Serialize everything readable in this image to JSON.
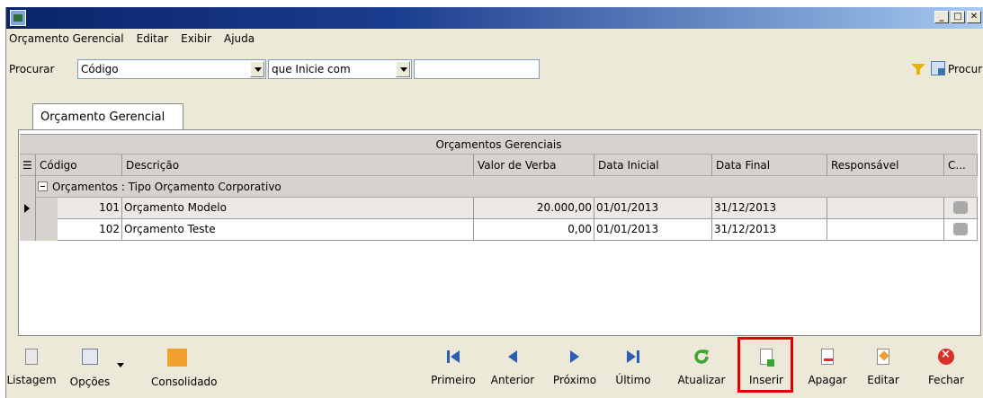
{
  "titlebar": {
    "buttons": [
      "_",
      "□",
      "✕"
    ]
  },
  "menu": {
    "items": [
      "Orçamento Gerencial",
      "Editar",
      "Exibir",
      "Ajuda"
    ]
  },
  "search": {
    "label": "Procurar",
    "field": "Código",
    "operator": "que Inicie com",
    "value": "",
    "button_label": "Procurar"
  },
  "tab": {
    "label": "Orçamento Gerencial"
  },
  "grid": {
    "group_header": "Orçamentos Gerenciais",
    "columns": [
      "Código",
      "Descrição",
      "Valor de Verba",
      "Data Inicial",
      "Data Final",
      "Responsável",
      "C..."
    ],
    "group_row": "Orçamentos : Tipo Orçamento Corporativo",
    "rows": [
      {
        "codigo": "101",
        "descricao": "Orçamento Modelo",
        "valor": "20.000,00",
        "inicio": "01/01/2013",
        "fim": "31/12/2013",
        "responsavel": ""
      },
      {
        "codigo": "102",
        "descricao": "Orçamento Teste",
        "valor": "0,00",
        "inicio": "01/01/2013",
        "fim": "31/12/2013",
        "responsavel": ""
      }
    ]
  },
  "toolbar": {
    "listagem": "Listagem",
    "opcoes": "Opções",
    "consolidado": "Consolidado",
    "primeiro": "Primeiro",
    "anterior": "Anterior",
    "proximo": "Próximo",
    "ultimo": "Último",
    "atualizar": "Atualizar",
    "inserir": "Inserir",
    "apagar": "Apagar",
    "editar": "Editar",
    "fechar": "Fechar"
  }
}
